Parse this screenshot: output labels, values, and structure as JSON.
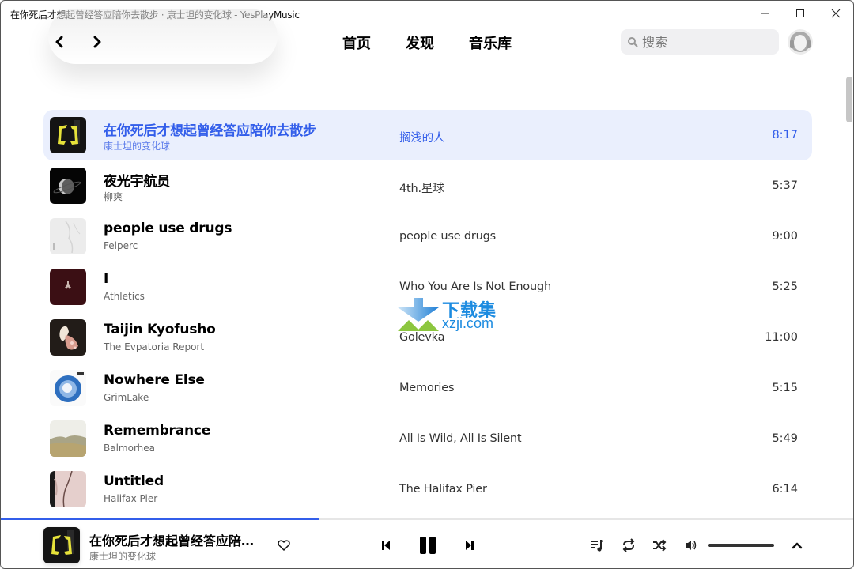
{
  "window": {
    "title": "在你死后才想起曾经答应陪你去散步 · 康士坦的变化球 - YesPlayMusic",
    "controls": [
      "minimize",
      "maximize",
      "close"
    ]
  },
  "nav": {
    "back_icon": "chevron-left-icon",
    "forward_icon": "chevron-right-icon",
    "links": [
      {
        "label": "首页"
      },
      {
        "label": "发现"
      },
      {
        "label": "音乐库"
      }
    ],
    "search": {
      "placeholder": "搜索",
      "value": ""
    },
    "avatar_icon": "user-avatar-icon"
  },
  "tracks": [
    {
      "name": "在你死后才想起曾经答应陪你去散步",
      "artist": "康士坦的变化球",
      "album": "搁浅的人",
      "duration": "8:17",
      "active": true,
      "cover": "yellow-logo"
    },
    {
      "name": "夜光宇航员",
      "artist": "柳爽",
      "album": "4th.星球",
      "duration": "5:37",
      "active": false,
      "cover": "moon"
    },
    {
      "name": "people use drugs",
      "artist": "Felperc",
      "album": "people use drugs",
      "duration": "9:00",
      "active": false,
      "cover": "white"
    },
    {
      "name": "I",
      "artist": "Athletics",
      "album": "Who You Are Is Not Enough",
      "duration": "5:25",
      "active": false,
      "cover": "maroon"
    },
    {
      "name": "Taijin Kyofusho",
      "artist": "The Evpatoria Report",
      "album": "Golevka",
      "duration": "11:00",
      "active": false,
      "cover": "flower"
    },
    {
      "name": "Nowhere Else",
      "artist": "GrimLake",
      "album": "Memories",
      "duration": "5:15",
      "active": false,
      "cover": "blue-circle"
    },
    {
      "name": "Remembrance",
      "artist": "Balmorhea",
      "album": "All Is Wild, All Is Silent",
      "duration": "5:49",
      "active": false,
      "cover": "desert"
    },
    {
      "name": "Untitled",
      "artist": "Halifax Pier",
      "album": "The Halifax Pier",
      "duration": "6:14",
      "active": false,
      "cover": "pink"
    }
  ],
  "watermark": {
    "cn": "下载集",
    "en": "xzji.com"
  },
  "player": {
    "title": "在你死后才想起曾经答应陪你去散步",
    "artist": "康士坦的变化球",
    "progress_fraction": 0.373,
    "volume_fraction": 1.0,
    "state": "playing",
    "colors": {
      "accent": "#335eea",
      "active_row_bg": "#eaeffd"
    }
  }
}
